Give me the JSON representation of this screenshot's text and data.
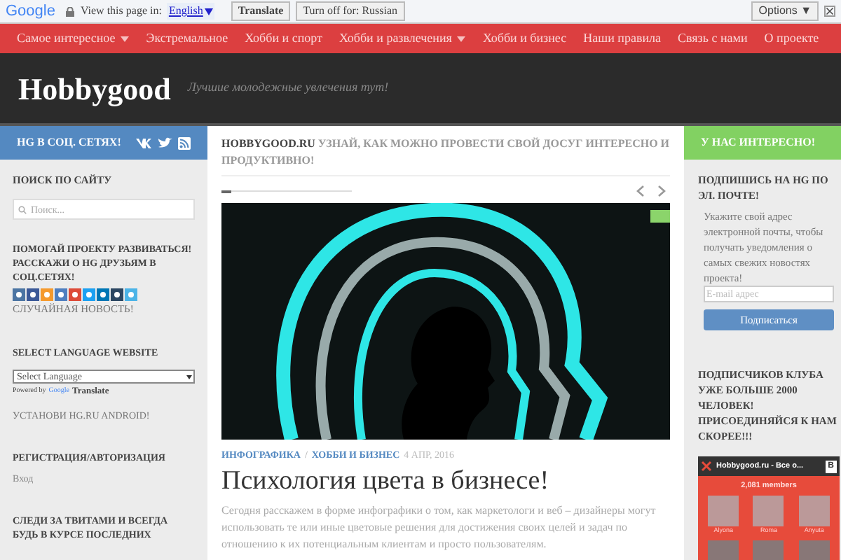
{
  "translate_bar": {
    "logo": "Google",
    "prompt": "View this page in:",
    "language": "English",
    "translate_button": "Translate",
    "turn_off_button": "Turn off for: Russian",
    "options_button": "Options ▼"
  },
  "nav": {
    "items": [
      {
        "label": "Самое интересное",
        "dropdown": true
      },
      {
        "label": "Экстремальное",
        "dropdown": false
      },
      {
        "label": "Хобби и спорт",
        "dropdown": false
      },
      {
        "label": "Хобби и развлечения",
        "dropdown": true
      },
      {
        "label": "Хобби и бизнес",
        "dropdown": false
      },
      {
        "label": "Наши правила",
        "dropdown": false
      },
      {
        "label": "Связь с нами",
        "dropdown": false
      },
      {
        "label": "О проекте",
        "dropdown": false
      }
    ]
  },
  "header": {
    "title": "Hobbygood",
    "tagline": "Лучшие молодежные увлечения тут!"
  },
  "left_sidebar": {
    "social_heading": "HG В СОЦ. СЕТЯХ!",
    "search_heading": "ПОИСК ПО САЙТУ",
    "search_placeholder": "Поиск...",
    "share_heading": "ПОМОГАЙ ПРОЕКТУ РАЗВИВАТЬСЯ! РАССКАЖИ О HG ДРУЗЬЯМ В СОЦ.СЕТЯХ!",
    "share_buttons": [
      {
        "color": "#4c75a3"
      },
      {
        "color": "#3b5998"
      },
      {
        "color": "#f59a2e"
      },
      {
        "color": "#4f7fc0"
      },
      {
        "color": "#dd4b39"
      },
      {
        "color": "#1da1f2"
      },
      {
        "color": "#0077b5"
      },
      {
        "color": "#2c4762"
      },
      {
        "color": "#4cb4e7"
      }
    ],
    "random_news": "СЛУЧАЙНАЯ НОВОСТЬ!",
    "language_heading": "SELECT LANGUAGE WEBSITE",
    "language_select": "Select Language",
    "powered_by": "Powered by",
    "powered_logo": "Google",
    "powered_brand": "Translate",
    "android": "УСТАНОВИ HG.RU ANDROID!",
    "registration_heading": "РЕГИСТРАЦИЯ/АВТОРИЗАЦИЯ",
    "login_link": "Вход",
    "twitter_heading": "СЛЕДИ ЗА ТВИТАМИ И ВСЕГДА БУДЬ В КУРСЕ ПОСЛЕДНИХ"
  },
  "ticker": {
    "site": "HOBBYGOOD.RU",
    "text": "УЗНАЙ, КАК МОЖНО ПРОВЕСТИ СВОЙ ДОСУГ ИНТЕРЕСНО И ПРОДУКТИВНО!"
  },
  "post": {
    "categories": [
      "ИНФОГРАФИКА",
      "ХОББИ И БИЗНЕС"
    ],
    "separator": "/",
    "date": "4 АПР, 2016",
    "title": "Психология цвета в бизнесе!",
    "excerpt": "Сегодня расскажем в форме инфографики о том, как маркетологи и веб – дизайнеры могут использовать те или иные цветовые решения для достижения своих целей и задач по отношению к их потенциальным клиентам и просто пользователям."
  },
  "right_sidebar": {
    "heading": "У НАС ИНТЕРЕСНО!",
    "subscribe_heading": "ПОДПИШИСЬ НА HG ПО ЭЛ. ПОЧТЕ!",
    "subscribe_text": "Укажите свой адрес электронной почты, чтобы получать уведомления о самых свежих новостях проекта!",
    "email_placeholder": "E-mail адрес",
    "subscribe_button": "Подписаться",
    "club_heading": "ПОДПИСЧИКОВ КЛУБА УЖЕ БОЛЬШЕ 2000 ЧЕЛОВЕК! ПРИСОЕДИНЯЙСЯ К НАМ СКОРЕЕ!!!",
    "vk_widget": {
      "title": "Hobbygood.ru - Все о...",
      "logo": "B",
      "members": "2,081 members",
      "people": [
        "Alyona",
        "Roma",
        "Anyuta"
      ]
    }
  }
}
